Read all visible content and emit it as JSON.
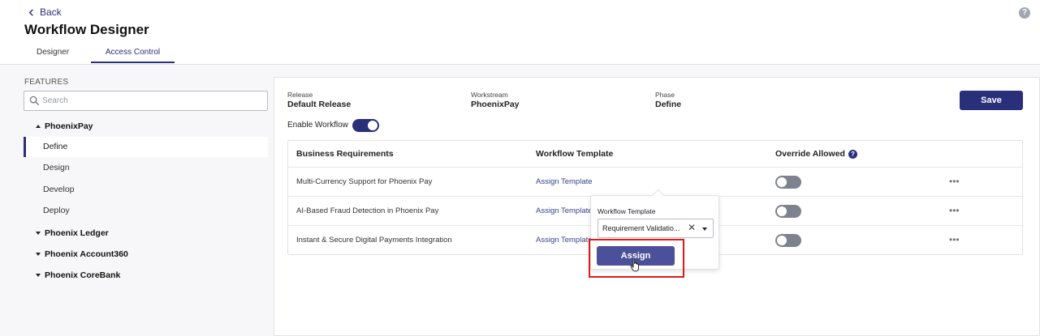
{
  "header": {
    "back_label": "Back",
    "title": "Workflow Designer",
    "help_symbol": "?"
  },
  "tabs": [
    {
      "label": "Designer",
      "active": false
    },
    {
      "label": "Access Control",
      "active": true
    }
  ],
  "sidebar": {
    "section_label": "FEATURES",
    "search_placeholder": "Search",
    "groups": [
      {
        "label": "PhoenixPay",
        "expanded": true,
        "items": [
          {
            "label": "Define",
            "active": true
          },
          {
            "label": "Design",
            "active": false
          },
          {
            "label": "Develop",
            "active": false
          },
          {
            "label": "Deploy",
            "active": false
          }
        ]
      },
      {
        "label": "Phoenix Ledger",
        "expanded": false
      },
      {
        "label": "Phoenix Account360",
        "expanded": false
      },
      {
        "label": "Phoenix CoreBank",
        "expanded": false
      }
    ]
  },
  "main": {
    "release_label": "Release",
    "release_value": "Default Release",
    "workstream_label": "Workstream",
    "workstream_value": "PhoenixPay",
    "phase_label": "Phase",
    "phase_value": "Define",
    "save_label": "Save",
    "enable_label": "Enable Workflow",
    "enable_on": true,
    "table": {
      "headers": [
        "Business Requirements",
        "Workflow Template",
        "Override Allowed"
      ],
      "rows": [
        {
          "requirement": "Multi-Currency Support for Phoenix Pay",
          "template": "Assign Template",
          "override": false
        },
        {
          "requirement": "AI-Based Fraud Detection in Phoenix Pay",
          "template": "Assign Template",
          "override": false
        },
        {
          "requirement": "Instant & Secure Digital Payments Integration",
          "template": "Assign Template",
          "override": false
        }
      ]
    }
  },
  "popover": {
    "label": "Workflow Template",
    "selected_value": "Requirement Validatio...",
    "clear_symbol": "✕",
    "assign_label": "Assign"
  },
  "colors": {
    "primary": "#2a2f7a",
    "assign_button": "#4c4f9a",
    "highlight_frame": "#e01818",
    "toggle_off": "#7e828e"
  }
}
